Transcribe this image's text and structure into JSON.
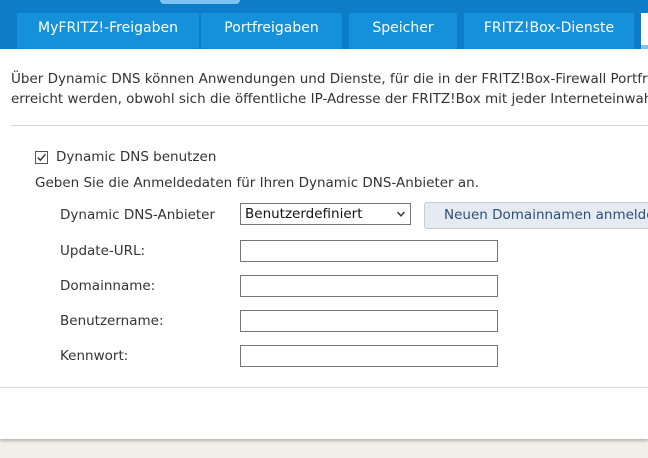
{
  "tabs": [
    {
      "label": "MyFRITZ!-Freigaben"
    },
    {
      "label": "Portfreigaben"
    },
    {
      "label": "Speicher"
    },
    {
      "label": "FRITZ!Box-Dienste"
    }
  ],
  "intro": {
    "line1": "Über Dynamic DNS können Anwendungen und Dienste, für die in der FRITZ!Box-Firewall Portfreig",
    "line2": "erreicht werden, obwohl sich die öffentliche IP-Adresse der FRITZ!Box mit jeder Interneteinwahl"
  },
  "ddns": {
    "checkbox_label": "Dynamic DNS benutzen",
    "checked": true,
    "hint": "Geben Sie die Anmeldedaten für Ihren Dynamic DNS-Anbieter an.",
    "provider_label": "Dynamic DNS-Anbieter",
    "provider_value": "Benutzerdefiniert",
    "register_button": "Neuen Domainnamen anmelde",
    "update_url_label": "Update-URL:",
    "update_url_value": "",
    "domain_label": "Domainname:",
    "domain_value": "",
    "username_label": "Benutzername:",
    "username_value": "",
    "password_label": "Kennwort:",
    "password_value": ""
  },
  "colors": {
    "brand_blue": "#0d7dc8",
    "tab_blue": "#1591dc",
    "button_bg": "#e6ebf1"
  }
}
